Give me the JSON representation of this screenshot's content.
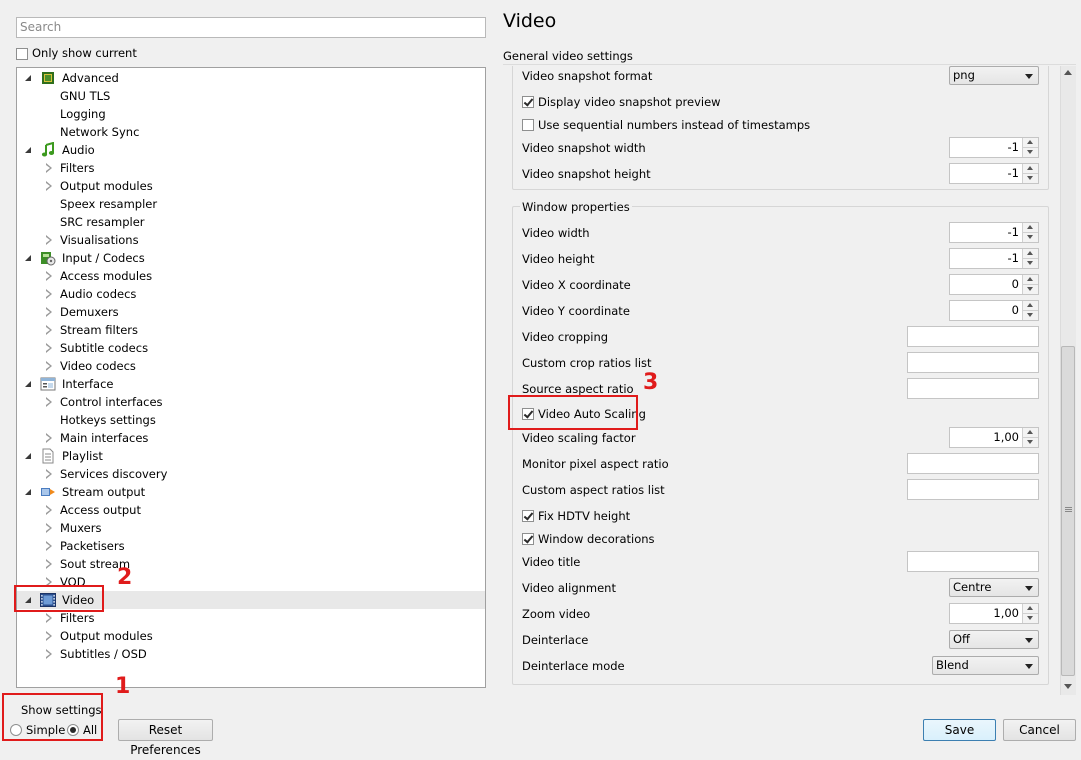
{
  "search": {
    "placeholder": "Search"
  },
  "only_show_current": {
    "label": "Only show current",
    "checked": false
  },
  "tree": [
    {
      "label": "Advanced",
      "level": 0,
      "expanded": true,
      "icon": "advanced-chip-icon"
    },
    {
      "label": "GNU TLS",
      "level": 1
    },
    {
      "label": "Logging",
      "level": 1
    },
    {
      "label": "Network Sync",
      "level": 1
    },
    {
      "label": "Audio",
      "level": 0,
      "expanded": true,
      "icon": "audio-note-icon"
    },
    {
      "label": "Filters",
      "level": 1,
      "has_children": true
    },
    {
      "label": "Output modules",
      "level": 1,
      "has_children": true
    },
    {
      "label": "Speex resampler",
      "level": 1
    },
    {
      "label": "SRC resampler",
      "level": 1
    },
    {
      "label": "Visualisations",
      "level": 1,
      "has_children": true
    },
    {
      "label": "Input / Codecs",
      "level": 0,
      "expanded": true,
      "icon": "input-codecs-icon"
    },
    {
      "label": "Access modules",
      "level": 1,
      "has_children": true
    },
    {
      "label": "Audio codecs",
      "level": 1,
      "has_children": true
    },
    {
      "label": "Demuxers",
      "level": 1,
      "has_children": true
    },
    {
      "label": "Stream filters",
      "level": 1,
      "has_children": true
    },
    {
      "label": "Subtitle codecs",
      "level": 1,
      "has_children": true
    },
    {
      "label": "Video codecs",
      "level": 1,
      "has_children": true
    },
    {
      "label": "Interface",
      "level": 0,
      "expanded": true,
      "icon": "interface-icon"
    },
    {
      "label": "Control interfaces",
      "level": 1,
      "has_children": true
    },
    {
      "label": "Hotkeys settings",
      "level": 1
    },
    {
      "label": "Main interfaces",
      "level": 1,
      "has_children": true
    },
    {
      "label": "Playlist",
      "level": 0,
      "expanded": true,
      "icon": "playlist-icon"
    },
    {
      "label": "Services discovery",
      "level": 1,
      "has_children": true
    },
    {
      "label": "Stream output",
      "level": 0,
      "expanded": true,
      "icon": "stream-output-icon"
    },
    {
      "label": "Access output",
      "level": 1,
      "has_children": true
    },
    {
      "label": "Muxers",
      "level": 1,
      "has_children": true
    },
    {
      "label": "Packetisers",
      "level": 1,
      "has_children": true
    },
    {
      "label": "Sout stream",
      "level": 1,
      "has_children": true
    },
    {
      "label": "VOD",
      "level": 1,
      "has_children": true
    },
    {
      "label": "Video",
      "level": 0,
      "expanded": true,
      "selected": true,
      "icon": "video-film-icon"
    },
    {
      "label": "Filters",
      "level": 1,
      "has_children": true
    },
    {
      "label": "Output modules",
      "level": 1,
      "has_children": true
    },
    {
      "label": "Subtitles / OSD",
      "level": 1,
      "has_children": true
    }
  ],
  "show_settings": {
    "title": "Show settings",
    "simple": "Simple",
    "all": "All",
    "selected": "All"
  },
  "buttons": {
    "reset": "Reset Preferences",
    "save": "Save",
    "cancel": "Cancel"
  },
  "annotations": {
    "n1": "1",
    "n2": "2",
    "n3": "3",
    "color": "#e01b1b"
  },
  "panel": {
    "title": "Video",
    "section": "General video settings",
    "snapshot": {
      "format_label": "Video snapshot format",
      "format_value": "png",
      "display_preview_label": "Display video snapshot preview",
      "display_preview_checked": true,
      "sequential_label": "Use sequential numbers instead of timestamps",
      "sequential_checked": false,
      "width_label": "Video snapshot width",
      "width_value": "-1",
      "height_label": "Video snapshot height",
      "height_value": "-1"
    },
    "window": {
      "group_title": "Window properties",
      "width_label": "Video width",
      "width_value": "-1",
      "height_label": "Video height",
      "height_value": "-1",
      "x_label": "Video X coordinate",
      "x_value": "0",
      "y_label": "Video Y coordinate",
      "y_value": "0",
      "cropping_label": "Video cropping",
      "crop_ratios_label": "Custom crop ratios list",
      "source_aspect_label": "Source aspect ratio",
      "auto_scaling_label": "Video Auto Scaling",
      "auto_scaling_checked": true,
      "scaling_factor_label": "Video scaling factor",
      "scaling_factor_value": "1,00",
      "monitor_aspect_label": "Monitor pixel aspect ratio",
      "custom_aspect_label": "Custom aspect ratios list",
      "fix_hdtv_label": "Fix HDTV height",
      "fix_hdtv_checked": true,
      "decorations_label": "Window decorations",
      "decorations_checked": true,
      "title_label": "Video title",
      "alignment_label": "Video alignment",
      "alignment_value": "Centre",
      "zoom_label": "Zoom video",
      "zoom_value": "1,00",
      "deinterlace_label": "Deinterlace",
      "deinterlace_value": "Off",
      "deinterlace_mode_label": "Deinterlace mode",
      "deinterlace_mode_value": "Blend"
    }
  }
}
